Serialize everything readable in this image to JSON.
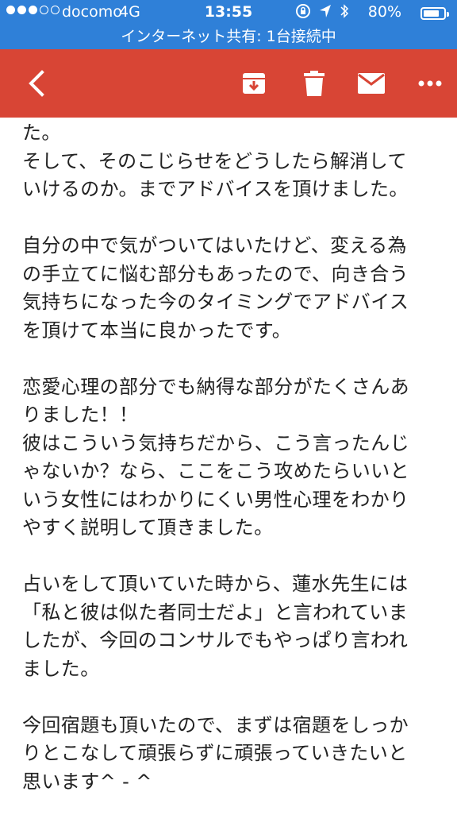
{
  "status_bar": {
    "carrier": "docomo",
    "network": "4G",
    "time": "13:55",
    "battery": "80%",
    "battery_level": 0.8,
    "tethering": "インターネット共有: 1台接続中"
  },
  "toolbar": {
    "icons": [
      "back-icon",
      "archive-icon",
      "trash-icon",
      "mail-icon",
      "more-icon"
    ],
    "color": "#d84535"
  },
  "message": {
    "lines": [
      "た。",
      "そして、そのこじらせをどうしたら解消して",
      "いけるのか。までアドバイスを頂けました。",
      "",
      "自分の中で気がついてはいたけど、変える為",
      "の手立てに悩む部分もあったので、向き合う",
      "気持ちになった今のタイミングでアドバイス",
      "を頂けて本当に良かったです。",
      "",
      "恋愛心理の部分でも納得な部分がたくさんあ",
      "りました！！",
      "彼はこういう気持ちだから、こう言ったんじ",
      "ゃないか？なら、ここをこう攻めたらいいと",
      "いう女性にはわかりにくい男性心理をわかり",
      "やすく説明して頂きました。",
      "",
      "占いをして頂いていた時から、蓮水先生には",
      "「私と彼は似た者同士だよ」と言われていま",
      "したが、今回のコンサルでもやっぱり言われ",
      "ました。",
      "",
      "今回宿題も頂いたので、まずは宿題をしっか",
      "りとこなして頑張らずに頑張っていきたいと",
      "思います^ - ^"
    ]
  }
}
